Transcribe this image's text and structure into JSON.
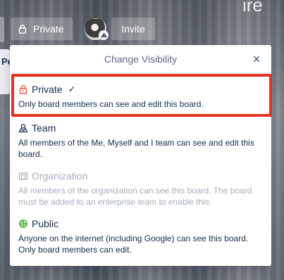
{
  "header": {
    "visibility_label": "Private",
    "invite_label": "Invite",
    "top_right_text": "ire",
    "list_peek_text": "Pe"
  },
  "popover": {
    "title": "Change Visibility",
    "close_glyph": "×",
    "options": [
      {
        "title": "Private",
        "icon": "lock-icon",
        "selected": true,
        "check_glyph": "✓",
        "description": "Only board members can see and edit this board."
      },
      {
        "title": "Team",
        "icon": "team-icon",
        "selected": false,
        "description": "All members of the Me, Myself and I team can see and edit this board."
      },
      {
        "title": "Organization",
        "icon": "organization-icon",
        "selected": false,
        "disabled": true,
        "description": "All members of the organization can see this board. The board must be added to an enterprise team to enable this."
      },
      {
        "title": "Public",
        "icon": "globe-icon",
        "selected": false,
        "description": "Anyone on the internet (including Google) can see this board. Only board members can edit."
      }
    ]
  },
  "colors": {
    "highlight": "#e53223",
    "private_icon": "#eb5a46",
    "public_icon": "#61bd4f",
    "text": "#172b4d",
    "disabled_text": "#a5adba"
  }
}
